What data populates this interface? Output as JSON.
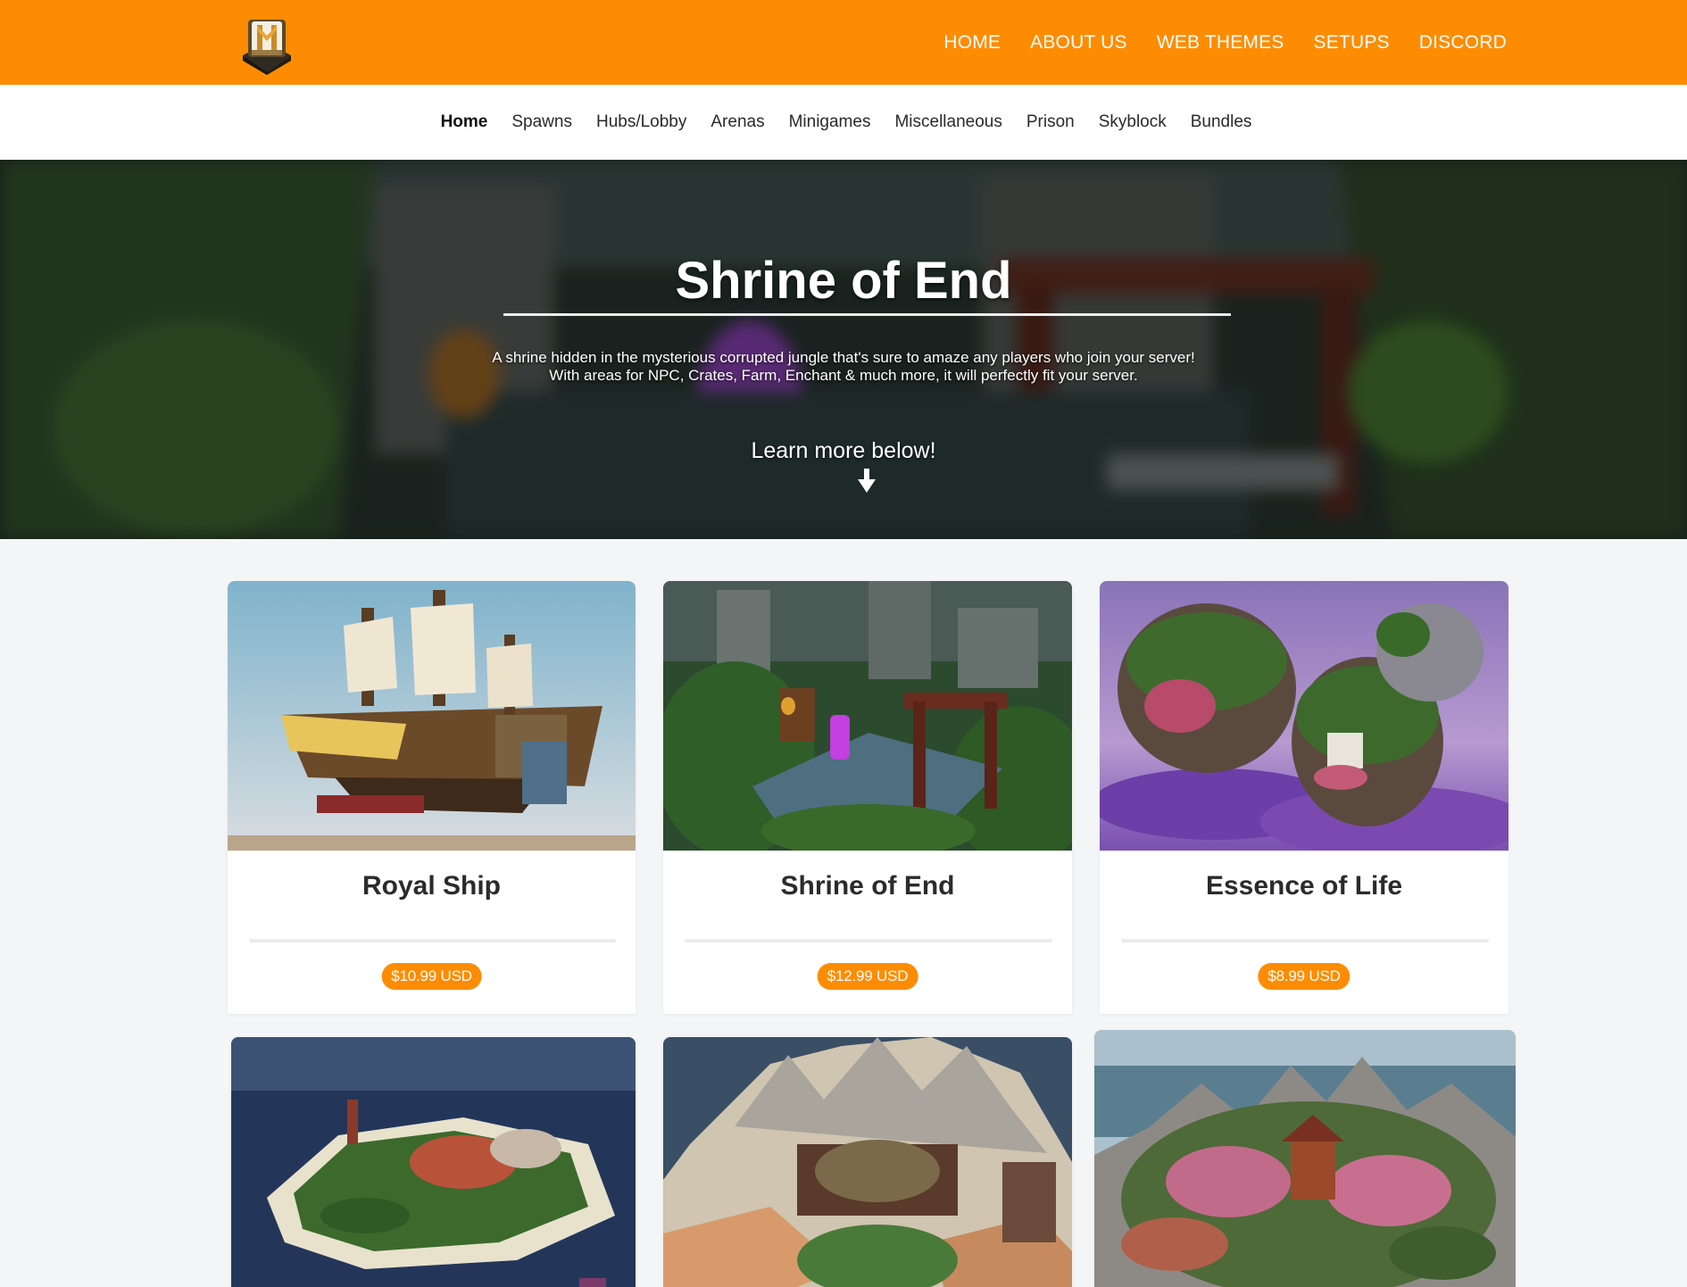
{
  "header": {
    "logo_icon": "block-logo-icon",
    "nav": [
      {
        "label": "HOME"
      },
      {
        "label": "ABOUT US"
      },
      {
        "label": "WEB THEMES"
      },
      {
        "label": "SETUPS"
      },
      {
        "label": "DISCORD"
      }
    ]
  },
  "categories": [
    {
      "label": "Home",
      "active": true
    },
    {
      "label": "Spawns"
    },
    {
      "label": "Hubs/Lobby"
    },
    {
      "label": "Arenas"
    },
    {
      "label": "Minigames"
    },
    {
      "label": "Miscellaneous"
    },
    {
      "label": "Prison"
    },
    {
      "label": "Skyblock"
    },
    {
      "label": "Bundles"
    }
  ],
  "hero": {
    "title": "Shrine of End",
    "description_line1": "A shrine hidden in the mysterious corrupted jungle that's sure to amaze any players who join your server!",
    "description_line2": "With areas for NPC, Crates, Farm, Enchant & much more, it will perfectly fit your server.",
    "learn_more": "Learn more below!",
    "arrow_icon": "arrow-down-icon"
  },
  "products": [
    {
      "title": "Royal Ship",
      "price": "$10.99 USD"
    },
    {
      "title": "Shrine of End",
      "price": "$12.99 USD"
    },
    {
      "title": "Essence of Life",
      "price": "$8.99 USD"
    }
  ],
  "colors": {
    "brand_orange": "#fd8c03",
    "page_bg": "#f4f5f7",
    "text_dark": "#2b2b2b"
  }
}
